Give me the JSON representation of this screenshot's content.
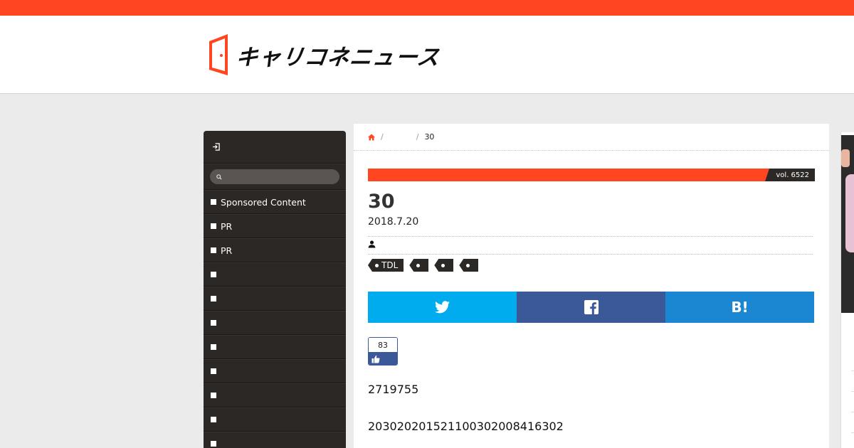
{
  "header": {
    "logo_text": "キャリコネニュース",
    "colors": {
      "accent": "#ff4620",
      "dark": "#2c2825"
    }
  },
  "sidebar": {
    "login_icon": "login-icon",
    "search_icon": "search-icon",
    "items": [
      {
        "label": "Sponsored Content"
      },
      {
        "label": "PR"
      },
      {
        "label": "PR"
      },
      {
        "label": ""
      },
      {
        "label": ""
      },
      {
        "label": ""
      },
      {
        "label": ""
      },
      {
        "label": ""
      },
      {
        "label": ""
      },
      {
        "label": ""
      },
      {
        "label": ""
      }
    ]
  },
  "breadcrumb": {
    "home_icon": "home-icon",
    "separator": "/",
    "middle": "",
    "current": "30"
  },
  "article": {
    "vol": "vol. 6522",
    "title": "30",
    "date": "2018.7.20",
    "author_icon": "person-icon",
    "author": "",
    "tags": [
      "TDL",
      "",
      "",
      ""
    ],
    "share": {
      "twitter_icon": "twitter-icon",
      "facebook_icon": "facebook-icon",
      "hatena_label": "B!"
    },
    "like_count": "83",
    "body": [
      "2719755",
      "2030202015211003020084163​02"
    ]
  }
}
